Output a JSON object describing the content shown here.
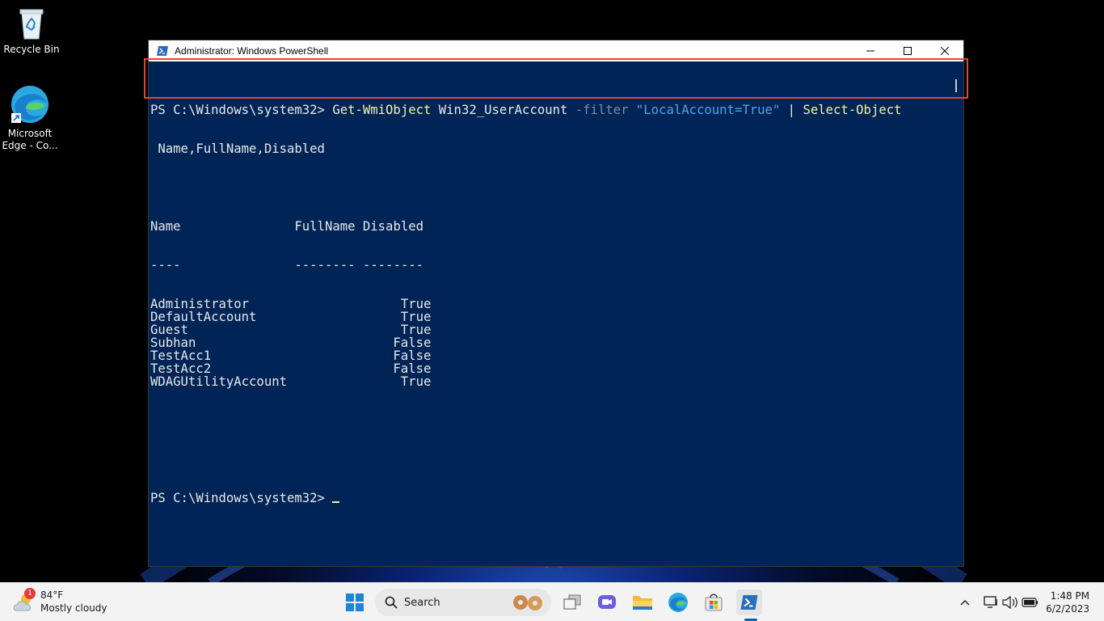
{
  "desktop": {
    "icons": [
      {
        "label": "Recycle Bin"
      },
      {
        "label": "Microsoft Edge - Co..."
      }
    ]
  },
  "window": {
    "title": "Administrator: Windows PowerShell",
    "controls": {
      "minimize": "minimize",
      "maximize": "maximize",
      "close": "close"
    }
  },
  "console": {
    "prompt": "PS C:\\Windows\\system32>",
    "command": {
      "cmdlet": "Get-WmiObject",
      "arg": "Win32_UserAccount",
      "param": "-filter",
      "string": "\"LocalAccount=True\"",
      "pipe": "|",
      "cmdlet2": "Select-Object",
      "line2": " Name,FullName,Disabled"
    },
    "headers": {
      "name": "Name",
      "fullname": "FullName",
      "disabled": "Disabled"
    },
    "underlines": {
      "name": "----",
      "fullname": "--------",
      "disabled": "--------"
    },
    "rows": [
      {
        "name": "Administrator",
        "fullname": "",
        "disabled": "True"
      },
      {
        "name": "DefaultAccount",
        "fullname": "",
        "disabled": "True"
      },
      {
        "name": "Guest",
        "fullname": "",
        "disabled": "True"
      },
      {
        "name": "Subhan",
        "fullname": "",
        "disabled": "False"
      },
      {
        "name": "TestAcc1",
        "fullname": "",
        "disabled": "False"
      },
      {
        "name": "TestAcc2",
        "fullname": "",
        "disabled": "False"
      },
      {
        "name": "WDAGUtilityAccount",
        "fullname": "",
        "disabled": "True"
      }
    ],
    "final_prompt": "PS C:\\Windows\\system32>"
  },
  "taskbar": {
    "weather": {
      "temp": "84°F",
      "condition": "Mostly cloudy",
      "badge": "1"
    },
    "search_label": "Search",
    "apps": [
      "start-icon",
      "search-icon",
      "task-view-icon",
      "chat-icon",
      "file-explorer-icon",
      "edge-icon",
      "store-icon",
      "powershell-icon"
    ],
    "tray": [
      "chevron-up-icon",
      "display-icon",
      "volume-icon",
      "battery-icon"
    ],
    "time": "1:48 PM",
    "date": "6/2/2023"
  },
  "colors": {
    "console_bg": "#012456",
    "prompt_text": "#e8e8e8",
    "cmdlet": "#f2f2a6",
    "parameter": "#7a8aa8",
    "string": "#4fa3e8",
    "highlight_box": "#e0443a",
    "accent": "#0067c0"
  }
}
